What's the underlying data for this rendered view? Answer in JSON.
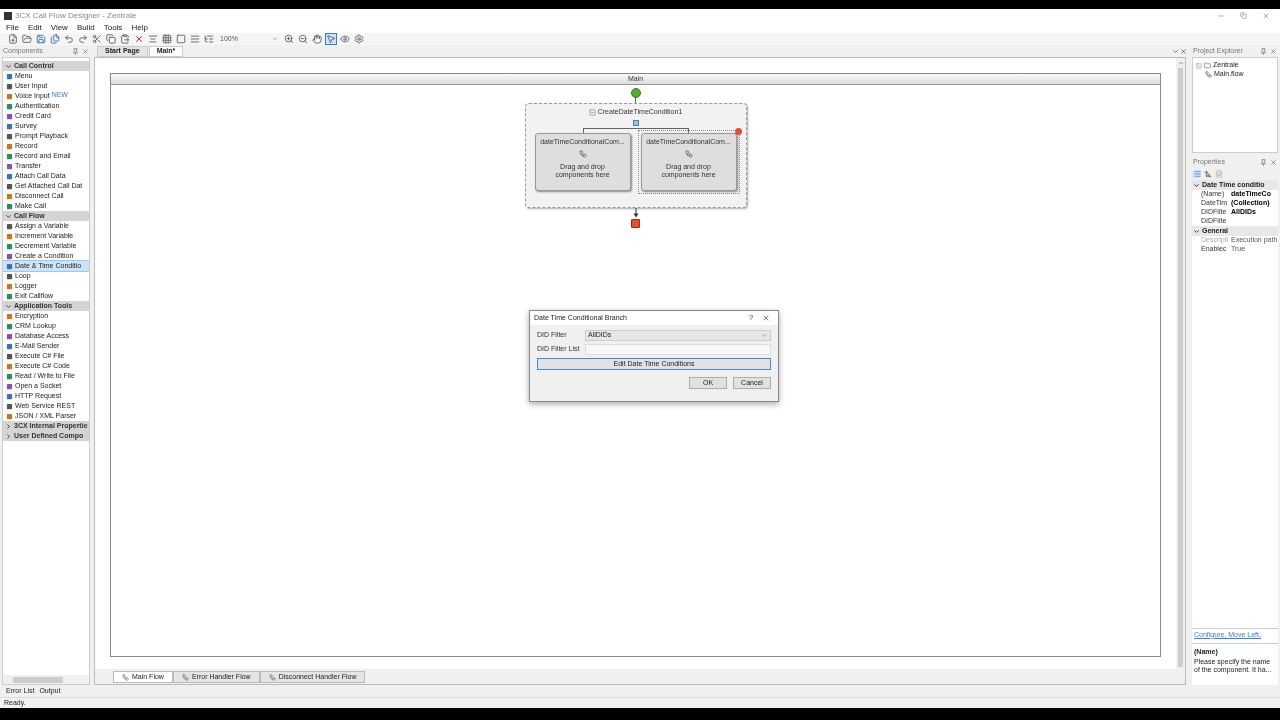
{
  "window": {
    "title": "3CX Call Flow Designer - Zentrale"
  },
  "menu": [
    "File",
    "Edit",
    "View",
    "Build",
    "Tools",
    "Help"
  ],
  "toolbar": {
    "zoom": "100%"
  },
  "components": {
    "title": "Components",
    "sections": [
      {
        "title": "Call Control",
        "expanded": true,
        "items": [
          {
            "label": "Menu",
            "selected": false
          },
          {
            "label": "User Input",
            "selected": false
          },
          {
            "label": "Voice Input",
            "badge": "NEW",
            "selected": false
          },
          {
            "label": "Authentication",
            "selected": false
          },
          {
            "label": "Credit Card",
            "selected": false
          },
          {
            "label": "Survey",
            "selected": false
          },
          {
            "label": "Prompt Playback",
            "selected": false
          },
          {
            "label": "Record",
            "selected": false
          },
          {
            "label": "Record and Email",
            "selected": false
          },
          {
            "label": "Transfer",
            "selected": false
          },
          {
            "label": "Attach Call Data",
            "selected": false
          },
          {
            "label": "Get Attached Call Dat",
            "selected": false
          },
          {
            "label": "Disconnect Call",
            "selected": false
          },
          {
            "label": "Make Call",
            "selected": false
          }
        ]
      },
      {
        "title": "Call Flow",
        "expanded": true,
        "items": [
          {
            "label": "Assign a Variable",
            "selected": false
          },
          {
            "label": "Increment Variable",
            "selected": false
          },
          {
            "label": "Decrement Variable",
            "selected": false
          },
          {
            "label": "Create a Condition",
            "selected": false
          },
          {
            "label": "Date & Time Conditio",
            "selected": true
          },
          {
            "label": "Loop",
            "selected": false
          },
          {
            "label": "Logger",
            "selected": false
          },
          {
            "label": "Exit Callflow",
            "selected": false
          }
        ]
      },
      {
        "title": "Application Tools",
        "expanded": true,
        "items": [
          {
            "label": "Encryption",
            "selected": false
          },
          {
            "label": "CRM Lookup",
            "selected": false
          },
          {
            "label": "Database Access",
            "selected": false
          },
          {
            "label": "E-Mail Sender",
            "selected": false
          },
          {
            "label": "Execute C# File",
            "selected": false
          },
          {
            "label": "Execute C# Code",
            "selected": false
          },
          {
            "label": "Read / Write to File",
            "selected": false
          },
          {
            "label": "Open a Socket",
            "selected": false
          },
          {
            "label": "HTTP Request",
            "selected": false
          },
          {
            "label": "Web Service REST",
            "selected": false
          },
          {
            "label": "JSON / XML Parser",
            "selected": false
          }
        ]
      },
      {
        "title": "3CX Internal Propertie",
        "expanded": false
      },
      {
        "title": "User Defined Compo",
        "expanded": false
      }
    ]
  },
  "document_tabs": [
    {
      "label": "Start Page",
      "selected": false
    },
    {
      "label": "Main*",
      "selected": true
    }
  ],
  "canvas": {
    "header": "Main",
    "condition": {
      "title": "CreateDateTimeCondition1",
      "branches": [
        {
          "title": "dateTimeConditionalCom...",
          "hint": "Drag and drop components here",
          "selected": false,
          "warning": false
        },
        {
          "title": "dateTimeConditionalCom...",
          "hint": "Drag and drop components here",
          "selected": true,
          "warning": true
        }
      ]
    }
  },
  "dialog": {
    "title": "Date Time Conditional Branch",
    "help": "?",
    "fields": [
      {
        "label": "DID Filter",
        "kind": "select",
        "value": "AllDIDs"
      },
      {
        "label": "DID Filter List",
        "kind": "text"
      }
    ],
    "action": "Edit Date Time Conditions",
    "buttons": [
      "OK",
      "Cancel"
    ]
  },
  "flow_tabs": [
    {
      "label": "Main Flow",
      "selected": true
    },
    {
      "label": "Error Handler Flow",
      "selected": false
    },
    {
      "label": "Disconnect Handler Flow",
      "selected": false
    }
  ],
  "project_explorer": {
    "title": "Project Explorer",
    "tree": [
      {
        "label": "Zentrale",
        "expanded": true,
        "children": [
          {
            "label": "Main.flow"
          }
        ]
      }
    ]
  },
  "properties": {
    "title": "Properties",
    "groups": [
      {
        "title": "Date Time conditio",
        "expanded": true,
        "rows": [
          {
            "name": "(Name)",
            "value": "dateTimeCo",
            "modified": true,
            "disabled": false
          },
          {
            "name": "DateTim",
            "value": "(Collection)",
            "modified": true,
            "disabled": false
          },
          {
            "name": "DIDFilte",
            "value": "AllDIDs",
            "modified": true,
            "disabled": false
          },
          {
            "name": "DIDFilte",
            "disabled": false
          }
        ]
      },
      {
        "title": "General",
        "expanded": true,
        "rows": [
          {
            "name": "Descripti",
            "value": "Execution path",
            "modified": false,
            "disabled": true
          },
          {
            "name": "Enablec",
            "value": "True",
            "modified": false,
            "disabled": false
          }
        ]
      }
    ],
    "commands": "Configure, Move Left,",
    "help_title": "(Name)",
    "help_text": "Please specify the name of the component. It ha..."
  },
  "output_tabs": [
    "Error List",
    "Output"
  ],
  "status": "Ready."
}
